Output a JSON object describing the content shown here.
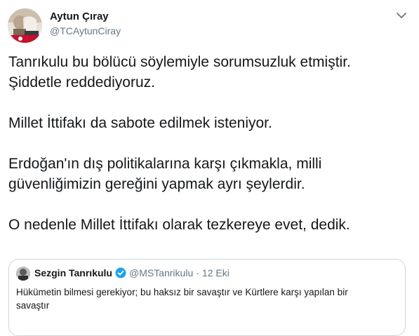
{
  "author": {
    "name": "Aytun Çıray",
    "handle": "@TCAytunCiray"
  },
  "tweet": {
    "text": "Tanrıkulu bu bölücü söylemiyle sorumsuzluk etmiştir.\nŞiddetle reddediyoruz.\n\nMillet İttifakı da sabote edilmek isteniyor.\n\nErdoğan'ın dış politikalarına karşı çıkmakla, milli güvenliğimizin gereğini yapmak ayrı şeylerdir.\n\nO nedenle Millet İttifakı olarak tezkereye evet, dedik."
  },
  "quoted": {
    "name": "Sezgin Tanrıkulu",
    "handle": "@MSTanrikulu",
    "separator": "·",
    "date": "12 Eki",
    "text": "Hükümetin bilmesi gerekiyor; bu haksız bir savaştır ve Kürtlere karşı yapılan bir savaştır"
  },
  "icons": {
    "menu": "chevron-down-icon",
    "verified": "verified-badge-icon"
  },
  "colors": {
    "text": "#14171a",
    "secondary": "#657786",
    "border": "#ccd6dd",
    "verified": "#1da1f2"
  }
}
